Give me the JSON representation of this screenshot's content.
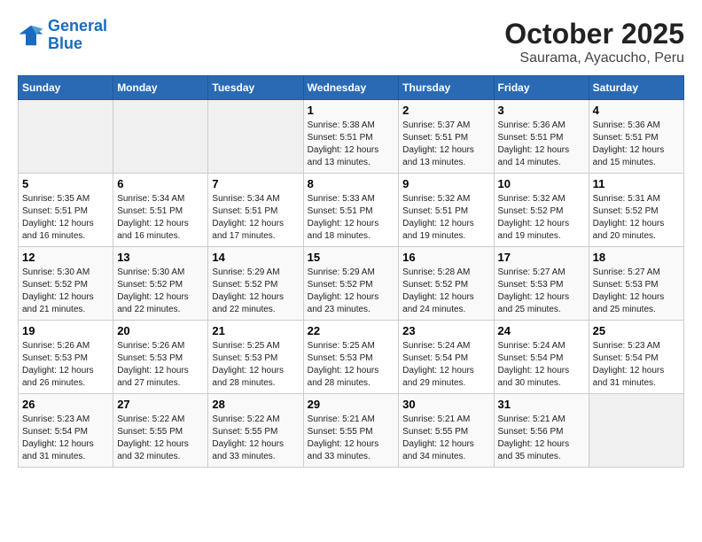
{
  "logo": {
    "line1": "General",
    "line2": "Blue"
  },
  "title": "October 2025",
  "location": "Saurama, Ayacucho, Peru",
  "weekdays": [
    "Sunday",
    "Monday",
    "Tuesday",
    "Wednesday",
    "Thursday",
    "Friday",
    "Saturday"
  ],
  "weeks": [
    [
      {
        "day": "",
        "info": ""
      },
      {
        "day": "",
        "info": ""
      },
      {
        "day": "",
        "info": ""
      },
      {
        "day": "1",
        "info": "Sunrise: 5:38 AM\nSunset: 5:51 PM\nDaylight: 12 hours and 13 minutes."
      },
      {
        "day": "2",
        "info": "Sunrise: 5:37 AM\nSunset: 5:51 PM\nDaylight: 12 hours and 13 minutes."
      },
      {
        "day": "3",
        "info": "Sunrise: 5:36 AM\nSunset: 5:51 PM\nDaylight: 12 hours and 14 minutes."
      },
      {
        "day": "4",
        "info": "Sunrise: 5:36 AM\nSunset: 5:51 PM\nDaylight: 12 hours and 15 minutes."
      }
    ],
    [
      {
        "day": "5",
        "info": "Sunrise: 5:35 AM\nSunset: 5:51 PM\nDaylight: 12 hours and 16 minutes."
      },
      {
        "day": "6",
        "info": "Sunrise: 5:34 AM\nSunset: 5:51 PM\nDaylight: 12 hours and 16 minutes."
      },
      {
        "day": "7",
        "info": "Sunrise: 5:34 AM\nSunset: 5:51 PM\nDaylight: 12 hours and 17 minutes."
      },
      {
        "day": "8",
        "info": "Sunrise: 5:33 AM\nSunset: 5:51 PM\nDaylight: 12 hours and 18 minutes."
      },
      {
        "day": "9",
        "info": "Sunrise: 5:32 AM\nSunset: 5:51 PM\nDaylight: 12 hours and 19 minutes."
      },
      {
        "day": "10",
        "info": "Sunrise: 5:32 AM\nSunset: 5:52 PM\nDaylight: 12 hours and 19 minutes."
      },
      {
        "day": "11",
        "info": "Sunrise: 5:31 AM\nSunset: 5:52 PM\nDaylight: 12 hours and 20 minutes."
      }
    ],
    [
      {
        "day": "12",
        "info": "Sunrise: 5:30 AM\nSunset: 5:52 PM\nDaylight: 12 hours and 21 minutes."
      },
      {
        "day": "13",
        "info": "Sunrise: 5:30 AM\nSunset: 5:52 PM\nDaylight: 12 hours and 22 minutes."
      },
      {
        "day": "14",
        "info": "Sunrise: 5:29 AM\nSunset: 5:52 PM\nDaylight: 12 hours and 22 minutes."
      },
      {
        "day": "15",
        "info": "Sunrise: 5:29 AM\nSunset: 5:52 PM\nDaylight: 12 hours and 23 minutes."
      },
      {
        "day": "16",
        "info": "Sunrise: 5:28 AM\nSunset: 5:52 PM\nDaylight: 12 hours and 24 minutes."
      },
      {
        "day": "17",
        "info": "Sunrise: 5:27 AM\nSunset: 5:53 PM\nDaylight: 12 hours and 25 minutes."
      },
      {
        "day": "18",
        "info": "Sunrise: 5:27 AM\nSunset: 5:53 PM\nDaylight: 12 hours and 25 minutes."
      }
    ],
    [
      {
        "day": "19",
        "info": "Sunrise: 5:26 AM\nSunset: 5:53 PM\nDaylight: 12 hours and 26 minutes."
      },
      {
        "day": "20",
        "info": "Sunrise: 5:26 AM\nSunset: 5:53 PM\nDaylight: 12 hours and 27 minutes."
      },
      {
        "day": "21",
        "info": "Sunrise: 5:25 AM\nSunset: 5:53 PM\nDaylight: 12 hours and 28 minutes."
      },
      {
        "day": "22",
        "info": "Sunrise: 5:25 AM\nSunset: 5:53 PM\nDaylight: 12 hours and 28 minutes."
      },
      {
        "day": "23",
        "info": "Sunrise: 5:24 AM\nSunset: 5:54 PM\nDaylight: 12 hours and 29 minutes."
      },
      {
        "day": "24",
        "info": "Sunrise: 5:24 AM\nSunset: 5:54 PM\nDaylight: 12 hours and 30 minutes."
      },
      {
        "day": "25",
        "info": "Sunrise: 5:23 AM\nSunset: 5:54 PM\nDaylight: 12 hours and 31 minutes."
      }
    ],
    [
      {
        "day": "26",
        "info": "Sunrise: 5:23 AM\nSunset: 5:54 PM\nDaylight: 12 hours and 31 minutes."
      },
      {
        "day": "27",
        "info": "Sunrise: 5:22 AM\nSunset: 5:55 PM\nDaylight: 12 hours and 32 minutes."
      },
      {
        "day": "28",
        "info": "Sunrise: 5:22 AM\nSunset: 5:55 PM\nDaylight: 12 hours and 33 minutes."
      },
      {
        "day": "29",
        "info": "Sunrise: 5:21 AM\nSunset: 5:55 PM\nDaylight: 12 hours and 33 minutes."
      },
      {
        "day": "30",
        "info": "Sunrise: 5:21 AM\nSunset: 5:55 PM\nDaylight: 12 hours and 34 minutes."
      },
      {
        "day": "31",
        "info": "Sunrise: 5:21 AM\nSunset: 5:56 PM\nDaylight: 12 hours and 35 minutes."
      },
      {
        "day": "",
        "info": ""
      }
    ]
  ]
}
